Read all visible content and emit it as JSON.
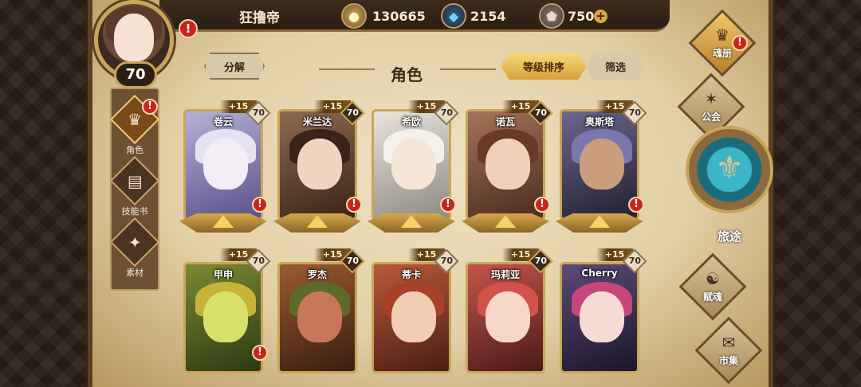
{
  "player": {
    "name": "狂撸帝",
    "level": "70"
  },
  "resources": {
    "gold": "130665",
    "crystal": "2154",
    "gem": "750",
    "gold_icon": "coin-icon",
    "crystal_icon": "crystal-icon",
    "gem_icon": "gem-icon"
  },
  "alert_mark": "!",
  "plus_mark": "+",
  "header": {
    "title": "角色",
    "decompose_label": "分解",
    "sort_label": "等级排序",
    "filter_label": "筛选"
  },
  "left_nav": [
    {
      "label": "角色",
      "icon": "helmet-icon"
    },
    {
      "label": "技能书",
      "icon": "skill-book-icon"
    },
    {
      "label": "素材",
      "icon": "material-icon"
    }
  ],
  "right_nav": [
    {
      "label": "魂册",
      "icon": "soul-book-icon"
    },
    {
      "label": "公会",
      "icon": "guild-icon"
    },
    {
      "label": "旅途",
      "icon": "journey-icon"
    },
    {
      "label": "赋魂",
      "icon": "ensoul-icon"
    },
    {
      "label": "市集",
      "icon": "market-icon"
    }
  ],
  "characters": [
    {
      "name": "卷云",
      "plus": "+15",
      "level": "70"
    },
    {
      "name": "米兰达",
      "plus": "+15",
      "level": "70"
    },
    {
      "name": "希欧",
      "plus": "+15",
      "level": "70"
    },
    {
      "name": "诺瓦",
      "plus": "+15",
      "level": "70"
    },
    {
      "name": "奥斯塔",
      "plus": "+15",
      "level": "70"
    },
    {
      "name": "甲申",
      "plus": "+15",
      "level": "70"
    },
    {
      "name": "罗杰",
      "plus": "+15",
      "level": "70"
    },
    {
      "name": "蒂卡",
      "plus": "+15",
      "level": "70"
    },
    {
      "name": "玛莉亚",
      "plus": "+15",
      "level": "70"
    },
    {
      "name": "Cherry",
      "plus": "+15",
      "level": "70"
    }
  ],
  "colors": {
    "accent_gold": "#c9a45a",
    "alert_red": "#c9241c",
    "parchment": "#e8d7b2"
  }
}
